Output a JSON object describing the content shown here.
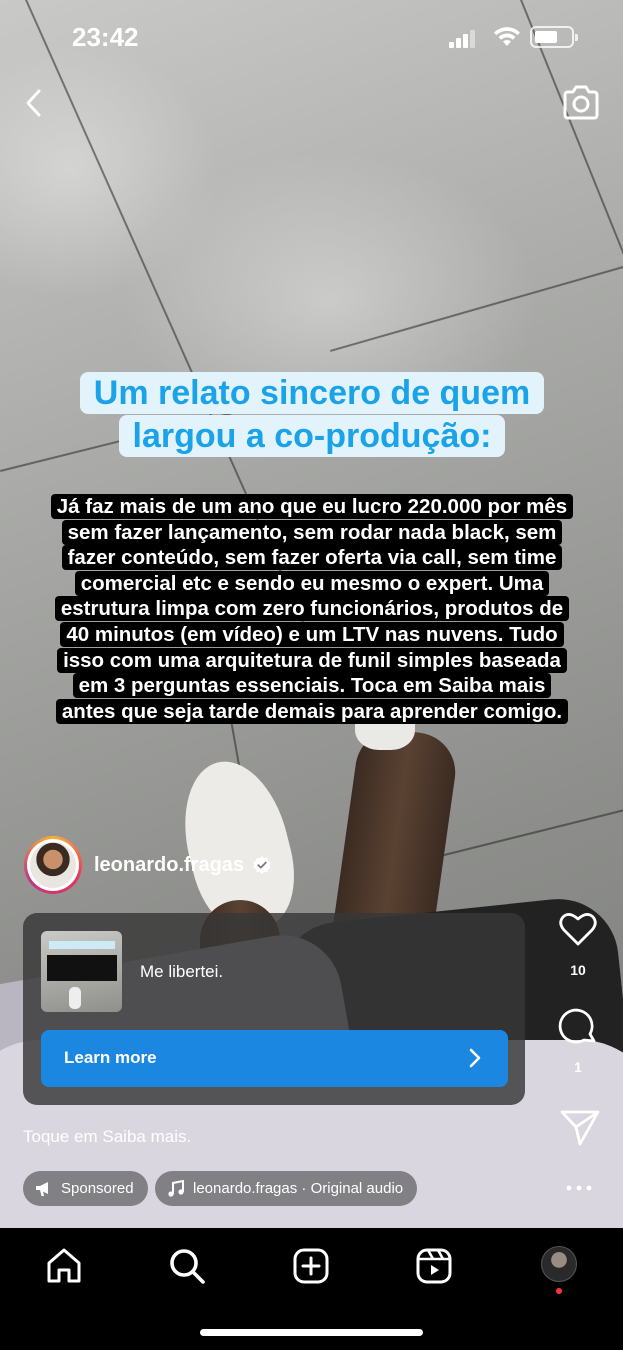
{
  "status_bar": {
    "time": "23:42"
  },
  "story": {
    "headline_lines": [
      "Um relato sincero de quem",
      "largou a co-produção:"
    ],
    "body_lines": [
      "Já faz mais de um ano que eu lucro 220.000 por mês",
      "sem fazer lançamento, sem rodar nada black, sem",
      "fazer conteúdo, sem fazer oferta via call, sem time",
      "comercial etc e sendo eu mesmo o expert. Uma",
      "estrutura limpa com zero funcionários, produtos de",
      "40 minutos (em vídeo) e um LTV nas nuvens. Tudo",
      "isso com uma arquitetura de funil simples baseada",
      "em 3 perguntas essenciais. Toca em Saiba mais",
      "antes que seja tarde demais para aprender comigo."
    ]
  },
  "account": {
    "username": "leonardo.fragas",
    "verified": true
  },
  "ad_card": {
    "caption": "Me libertei.",
    "cta_label": "Learn more"
  },
  "actions": {
    "like_count": "10",
    "comment_count": "1"
  },
  "tagline": "Toque em Saiba mais.",
  "pills": {
    "sponsored_label": "Sponsored",
    "audio_label": "leonardo.fragas · Original audio"
  },
  "colors": {
    "cta_blue": "#1b87e0",
    "headline_blue": "#1aa3e8",
    "notification_red": "#ff3040"
  },
  "icons": [
    "back-chevron-icon",
    "camera-icon",
    "verified-badge-icon",
    "chevron-right-icon",
    "heart-icon",
    "comment-icon",
    "share-send-icon",
    "megaphone-icon",
    "music-note-icon",
    "more-dots-icon",
    "home-icon",
    "search-icon",
    "create-plus-icon",
    "reels-icon"
  ]
}
